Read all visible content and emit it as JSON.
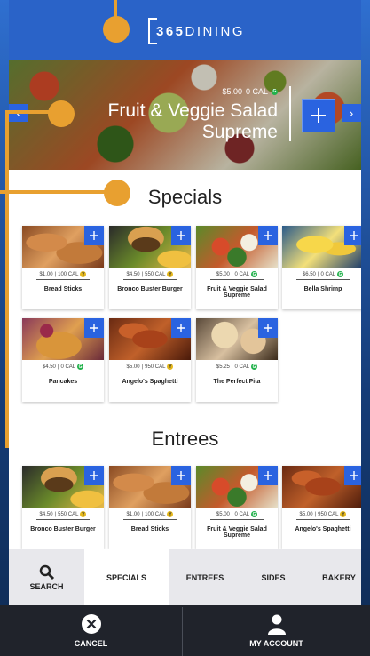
{
  "header": {
    "logo_prefix": "365",
    "logo_suffix": "DINING"
  },
  "featured": {
    "price": "$5.00",
    "calories": "0 CAL",
    "badge": "G",
    "title": "Fruit & Veggie Salad Supreme"
  },
  "sections": [
    {
      "title": "Specials",
      "items": [
        {
          "name": "Bread Sticks",
          "price": "$1.00",
          "calories": "100 CAL",
          "badge": "Y"
        },
        {
          "name": "Bronco Buster Burger",
          "price": "$4.50",
          "calories": "550 CAL",
          "badge": "Y"
        },
        {
          "name": "Fruit & Veggie Salad Supreme",
          "price": "$5.00",
          "calories": "0 CAL",
          "badge": "G"
        },
        {
          "name": "Bella Shrimp",
          "price": "$6.50",
          "calories": "0 CAL",
          "badge": "G"
        },
        {
          "name": "Pancakes",
          "price": "$4.50",
          "calories": "0 CAL",
          "badge": "G"
        },
        {
          "name": "Angelo's Spaghetti",
          "price": "$5.00",
          "calories": "950 CAL",
          "badge": "Y"
        },
        {
          "name": "The Perfect Pita",
          "price": "$5.25",
          "calories": "0 CAL",
          "badge": "G"
        }
      ]
    },
    {
      "title": "Entrees",
      "items": [
        {
          "name": "Bronco Buster Burger",
          "price": "$4.50",
          "calories": "550 CAL",
          "badge": "Y"
        },
        {
          "name": "Bread Sticks",
          "price": "$1.00",
          "calories": "100 CAL",
          "badge": "Y"
        },
        {
          "name": "Fruit & Veggie Salad Supreme",
          "price": "$5.00",
          "calories": "0 CAL",
          "badge": "G"
        },
        {
          "name": "Angelo's Spaghetti",
          "price": "$5.00",
          "calories": "950 CAL",
          "badge": "Y"
        }
      ]
    }
  ],
  "tabs": {
    "search": "SEARCH",
    "items": [
      "SPECIALS",
      "ENTREES",
      "SIDES",
      "BAKERY"
    ],
    "active": "SPECIALS"
  },
  "bottom_bar": {
    "cancel": "CANCEL",
    "account": "MY ACCOUNT"
  },
  "icons": {
    "add": "plus-icon",
    "search": "magnifier-icon",
    "cancel": "close-circle-icon",
    "account": "user-icon",
    "prev": "chevron-left-icon",
    "next": "chevron-right-icon"
  },
  "colors": {
    "brand_blue": "#2a63e0",
    "header_blue": "#2a63c8",
    "accent_orange": "#e8a030",
    "bottom_bar": "#20232b",
    "badge_yellow": "#e5b81c",
    "badge_green": "#22b24c"
  }
}
